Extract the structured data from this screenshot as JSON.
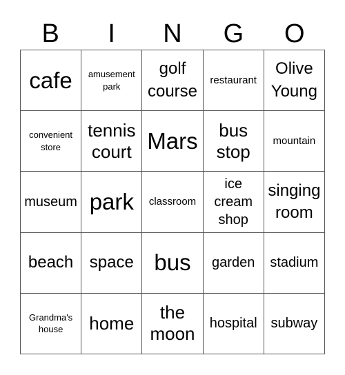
{
  "header": [
    "B",
    "I",
    "N",
    "G",
    "O"
  ],
  "cells": [
    {
      "text": "cafe",
      "size": "s6"
    },
    {
      "text": "amusement park",
      "size": "s1"
    },
    {
      "text": "golf course",
      "size": "s4"
    },
    {
      "text": "restaurant",
      "size": "s2"
    },
    {
      "text": "Olive Young",
      "size": "s4"
    },
    {
      "text": "convenient store",
      "size": "s1"
    },
    {
      "text": "tennis court",
      "size": "s5"
    },
    {
      "text": "Mars",
      "size": "s6"
    },
    {
      "text": "bus stop",
      "size": "s5"
    },
    {
      "text": "mountain",
      "size": "s2"
    },
    {
      "text": "museum",
      "size": "s3"
    },
    {
      "text": "park",
      "size": "s6"
    },
    {
      "text": "classroom",
      "size": "s2"
    },
    {
      "text": "ice cream shop",
      "size": "s3"
    },
    {
      "text": "singing room",
      "size": "s4"
    },
    {
      "text": "beach",
      "size": "s4"
    },
    {
      "text": "space",
      "size": "s4"
    },
    {
      "text": "bus",
      "size": "s6"
    },
    {
      "text": "garden",
      "size": "s3"
    },
    {
      "text": "stadium",
      "size": "s3"
    },
    {
      "text": "Grandma's house",
      "size": "s1"
    },
    {
      "text": "home",
      "size": "s5"
    },
    {
      "text": "the moon",
      "size": "s5"
    },
    {
      "text": "hospital",
      "size": "s3"
    },
    {
      "text": "subway",
      "size": "s3"
    }
  ]
}
